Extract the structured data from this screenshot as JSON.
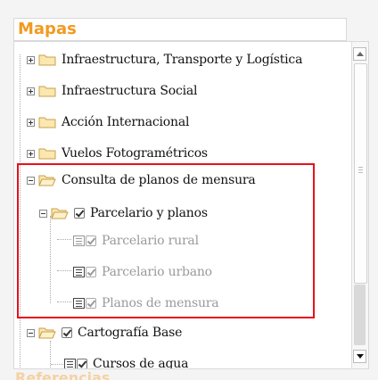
{
  "panel": {
    "title": "Mapas",
    "footer_peek": "Referencias"
  },
  "tree": [
    {
      "label": "Infraestructura, Transporte y Logística",
      "expander": "plus"
    },
    {
      "label": "Infraestructura Social",
      "expander": "plus"
    },
    {
      "label": "Acción Internacional",
      "expander": "plus"
    },
    {
      "label": "Vuelos Fotogramétricos",
      "expander": "plus"
    },
    {
      "label": "Consulta de planos de mensura",
      "expander": "minus"
    },
    {
      "label": "Parcelario y planos",
      "expander": "minus",
      "checked": true
    },
    {
      "label": "Parcelario rural",
      "checked": true,
      "disabled": true
    },
    {
      "label": "Parcelario urbano",
      "checked": true,
      "disabled": true
    },
    {
      "label": "Planos de mensura",
      "checked": true,
      "disabled": true
    },
    {
      "label": "Cartografía Base",
      "expander": "minus",
      "checked": true
    },
    {
      "label": "Cursos de agua",
      "checked": true
    }
  ],
  "icons": {
    "folder": "folder-icon",
    "folder_open": "folder-open-icon",
    "legend": "legend-list-icon",
    "check": "checkbox-checked-icon"
  },
  "colors": {
    "title": "#f29a1f",
    "highlight": "#e8101c",
    "disabled_text": "#9a9a9a"
  }
}
